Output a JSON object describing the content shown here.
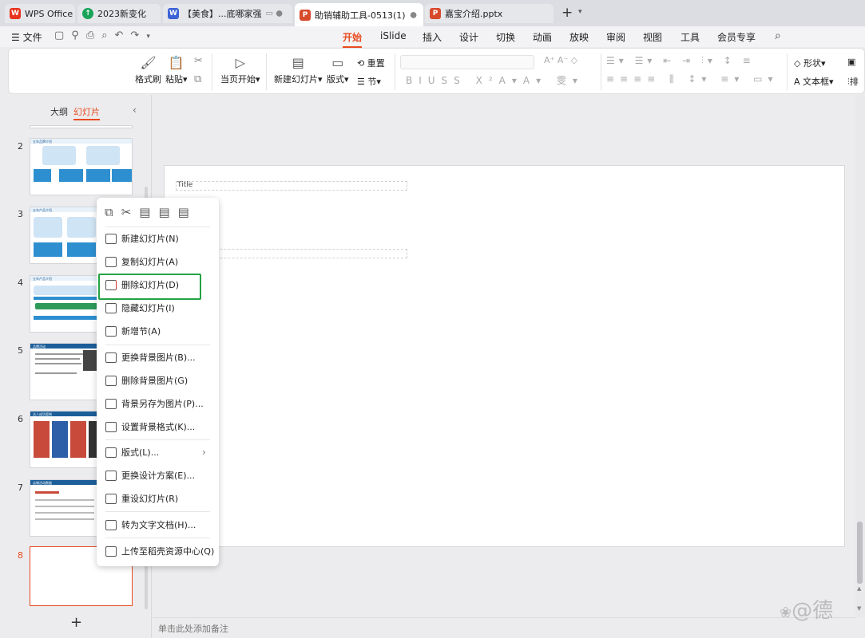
{
  "tabs": [
    {
      "label": "WPS Office",
      "icon": "wps-logo-icon",
      "color": "#e8331d"
    },
    {
      "label": "2023新变化",
      "icon": "upload-circle-icon",
      "color": "#1aa35a"
    },
    {
      "label": "【美食】...底哪家强",
      "icon": "writer-doc-icon",
      "color": "#3b62d6"
    },
    {
      "label": "助销辅助工具-0513(1)",
      "icon": "presentation-icon",
      "color": "#d84a2c"
    },
    {
      "label": "嘉宝介绍.pptx",
      "icon": "presentation-icon",
      "color": "#d84a2c"
    }
  ],
  "add_tab": "+",
  "file_menu": "文件",
  "menu_tabs": [
    "开始",
    "iSlide",
    "插入",
    "设计",
    "切换",
    "动画",
    "放映",
    "审阅",
    "视图",
    "工具",
    "会员专享"
  ],
  "ribbon": {
    "format_painter": "格式刷",
    "paste": "粘贴",
    "from_current": "当页开始",
    "new_slide": "新建幻灯片",
    "layout": "版式",
    "section": "节",
    "reset": "重置",
    "shape": "形状",
    "textbox": "文本框",
    "arrange": "排"
  },
  "panel": {
    "outline_tab": "大纲",
    "slides_tab": "幻灯片",
    "add": "+"
  },
  "slides": [
    {
      "num": "2",
      "title": "五年品牌介绍"
    },
    {
      "num": "3",
      "title": "五年产品介绍"
    },
    {
      "num": "4",
      "title": "五年产品介绍"
    },
    {
      "num": "5",
      "title": "品牌活动"
    },
    {
      "num": "6",
      "title": "达人成功案例"
    },
    {
      "num": "7",
      "title": "店铺活动数据"
    },
    {
      "num": "8",
      "title": ""
    }
  ],
  "slide": {
    "title_placeholder": "Title"
  },
  "notes": "单击此处添加备注",
  "context_menu": [
    {
      "label": "新建幻灯片(N)",
      "icon": "new-slide-icon"
    },
    {
      "label": "复制幻灯片(A)",
      "icon": "duplicate-slide-icon"
    },
    {
      "label": "删除幻灯片(D)",
      "icon": "delete-slide-icon"
    },
    {
      "label": "隐藏幻灯片(I)",
      "icon": "hide-slide-icon"
    },
    {
      "label": "新增节(A)",
      "icon": "add-section-icon"
    },
    {
      "label": "更换背景图片(B)...",
      "icon": "change-background-icon"
    },
    {
      "label": "删除背景图片(G)",
      "icon": "delete-background-icon"
    },
    {
      "label": "背景另存为图片(P)...",
      "icon": "save-background-icon"
    },
    {
      "label": "设置背景格式(K)...",
      "icon": "background-format-icon"
    },
    {
      "label": "版式(L)...",
      "icon": "layout-icon"
    },
    {
      "label": "更换设计方案(E)...",
      "icon": "design-scheme-icon"
    },
    {
      "label": "重设幻灯片(R)",
      "icon": "reset-slide-icon"
    },
    {
      "label": "转为文字文档(H)...",
      "icon": "convert-doc-icon"
    },
    {
      "label": "上传至稻壳资源中心(Q)",
      "icon": "upload-icon"
    }
  ],
  "watermark": "@德",
  "accent": "#e84a1f",
  "highlight_color": "#25a244"
}
